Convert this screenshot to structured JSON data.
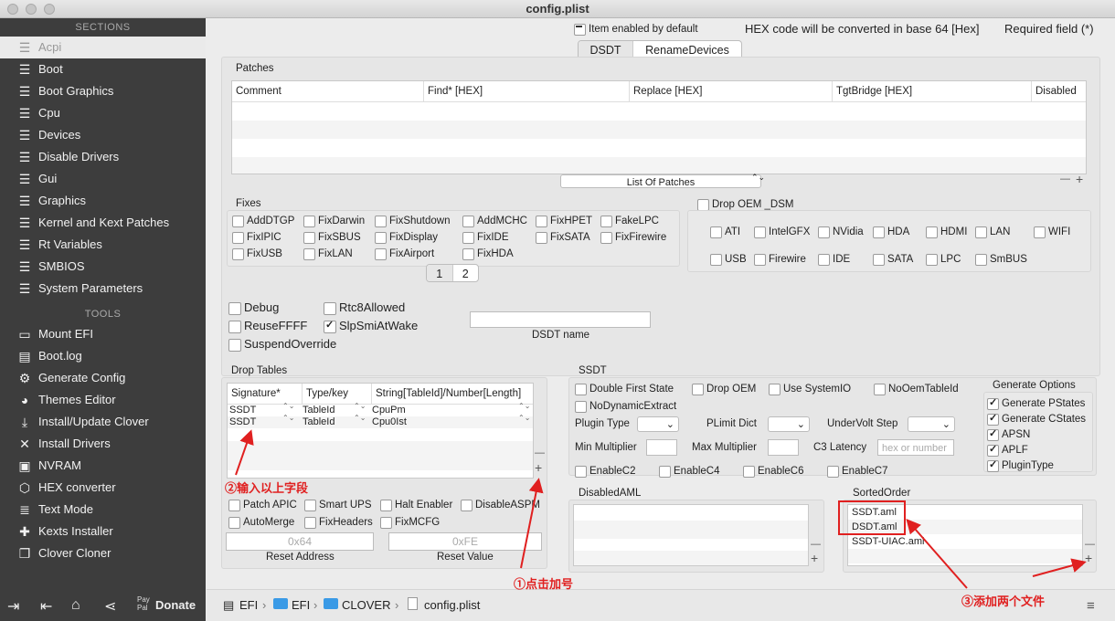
{
  "window": {
    "title": "config.plist"
  },
  "sidebar": {
    "sections_header": "SECTIONS",
    "tools_header": "TOOLS",
    "sections": [
      {
        "label": "Acpi",
        "icon": "list-icon",
        "selected": true
      },
      {
        "label": "Boot",
        "icon": "list-icon"
      },
      {
        "label": "Boot Graphics",
        "icon": "list-icon"
      },
      {
        "label": "Cpu",
        "icon": "list-icon"
      },
      {
        "label": "Devices",
        "icon": "list-icon"
      },
      {
        "label": "Disable Drivers",
        "icon": "list-icon"
      },
      {
        "label": "Gui",
        "icon": "list-icon"
      },
      {
        "label": "Graphics",
        "icon": "list-icon"
      },
      {
        "label": "Kernel and Kext Patches",
        "icon": "list-icon"
      },
      {
        "label": "Rt Variables",
        "icon": "list-icon"
      },
      {
        "label": "SMBIOS",
        "icon": "list-icon"
      },
      {
        "label": "System Parameters",
        "icon": "list-icon"
      }
    ],
    "tools": [
      {
        "label": "Mount EFI",
        "icon": "drive-icon"
      },
      {
        "label": "Boot.log",
        "icon": "log-icon"
      },
      {
        "label": "Generate Config",
        "icon": "gear-icon"
      },
      {
        "label": "Themes Editor",
        "icon": "palette-icon"
      },
      {
        "label": "Install/Update Clover",
        "icon": "download-icon"
      },
      {
        "label": "Install Drivers",
        "icon": "tools-icon"
      },
      {
        "label": "NVRAM",
        "icon": "chip-icon"
      },
      {
        "label": "HEX converter",
        "icon": "hex-icon"
      },
      {
        "label": "Text Mode",
        "icon": "text-icon"
      },
      {
        "label": "Kexts Installer",
        "icon": "puzzle-icon"
      },
      {
        "label": "Clover Cloner",
        "icon": "clone-icon"
      }
    ],
    "donate": {
      "paypal": "Pay Pal",
      "label": "Donate"
    }
  },
  "topbar": {
    "item_enabled_default": "Item enabled by default",
    "hex_note": "HEX code will be converted in base 64 [Hex]",
    "required_note": "Required field (*)",
    "tabs": [
      "DSDT",
      "RenameDevices"
    ]
  },
  "patches": {
    "title": "Patches",
    "columns": [
      "Comment",
      "Find* [HEX]",
      "Replace [HEX]",
      "TgtBridge [HEX]",
      "Disabled"
    ],
    "popup": "List Of Patches"
  },
  "fixes": {
    "title": "Fixes",
    "items": [
      "AddDTGP",
      "FixDarwin",
      "FixShutdown",
      "AddMCHC",
      "FixHPET",
      "FakeLPC",
      "FixIPIC",
      "FixSBUS",
      "FixDisplay",
      "FixIDE",
      "FixSATA",
      "FixFirewire",
      "FixUSB",
      "FixLAN",
      "FixAirport",
      "FixHDA"
    ],
    "pages": [
      "1",
      "2"
    ]
  },
  "drop_oem": {
    "label": "Drop OEM _DSM",
    "items": [
      "ATI",
      "IntelGFX",
      "NVidia",
      "HDA",
      "HDMI",
      "LAN",
      "WIFI",
      "USB",
      "Firewire",
      "IDE",
      "SATA",
      "LPC",
      "SmBUS"
    ]
  },
  "options": {
    "debug": "Debug",
    "rtc8": "Rtc8Allowed",
    "reuseffff": "ReuseFFFF",
    "slpsmi": "SlpSmiAtWake",
    "suspend": "SuspendOverride",
    "dsdt_name_label": "DSDT name"
  },
  "drop_tables": {
    "title": "Drop Tables",
    "columns": [
      "Signature*",
      "Type/key",
      "String[TableId]/Number[Length]"
    ],
    "rows": [
      {
        "sig": "SSDT",
        "type": "TableId",
        "str": "CpuPm"
      },
      {
        "sig": "SSDT",
        "type": "TableId",
        "str": "Cpu0Ist"
      }
    ],
    "checks": [
      "Patch APIC",
      "Smart UPS",
      "Halt Enabler",
      "DisableASPM",
      "AutoMerge",
      "FixHeaders",
      "FixMCFG"
    ],
    "reset_address_value": "0x64",
    "reset_address_label": "Reset Address",
    "reset_value_value": "0xFE",
    "reset_value_label": "Reset Value"
  },
  "ssdt": {
    "title": "SSDT",
    "checks_row1": [
      "Double First State",
      "Drop OEM",
      "Use SystemIO",
      "NoOemTableId"
    ],
    "no_dynamic": "NoDynamicExtract",
    "plugin_type": "Plugin Type",
    "plimit": "PLimit Dict",
    "undervolt": "UnderVolt Step",
    "min_mult": "Min Multiplier",
    "max_mult": "Max Multiplier",
    "c3": "C3 Latency",
    "c3_placeholder": "hex or number",
    "cstates": [
      "EnableC2",
      "EnableC4",
      "EnableC6",
      "EnableC7"
    ],
    "gen_title": "Generate Options",
    "gen": [
      "Generate PStates",
      "Generate CStates",
      "APSN",
      "APLF",
      "PluginType"
    ]
  },
  "disabled_aml": {
    "title": "DisabledAML"
  },
  "sorted_order": {
    "title": "SortedOrder",
    "items": [
      "SSDT.aml",
      "DSDT.aml",
      "SSDT-UIAC.aml"
    ]
  },
  "path": {
    "segments": [
      "EFI",
      "EFI",
      "CLOVER",
      "config.plist"
    ],
    "sep": "›"
  },
  "annotations": {
    "a1": "①点击加号",
    "a2": "②输入以上字段",
    "a3": "③添加两个文件"
  },
  "glyphs": {
    "plus": "+",
    "minus": "—",
    "updown": "⌃⌄"
  }
}
